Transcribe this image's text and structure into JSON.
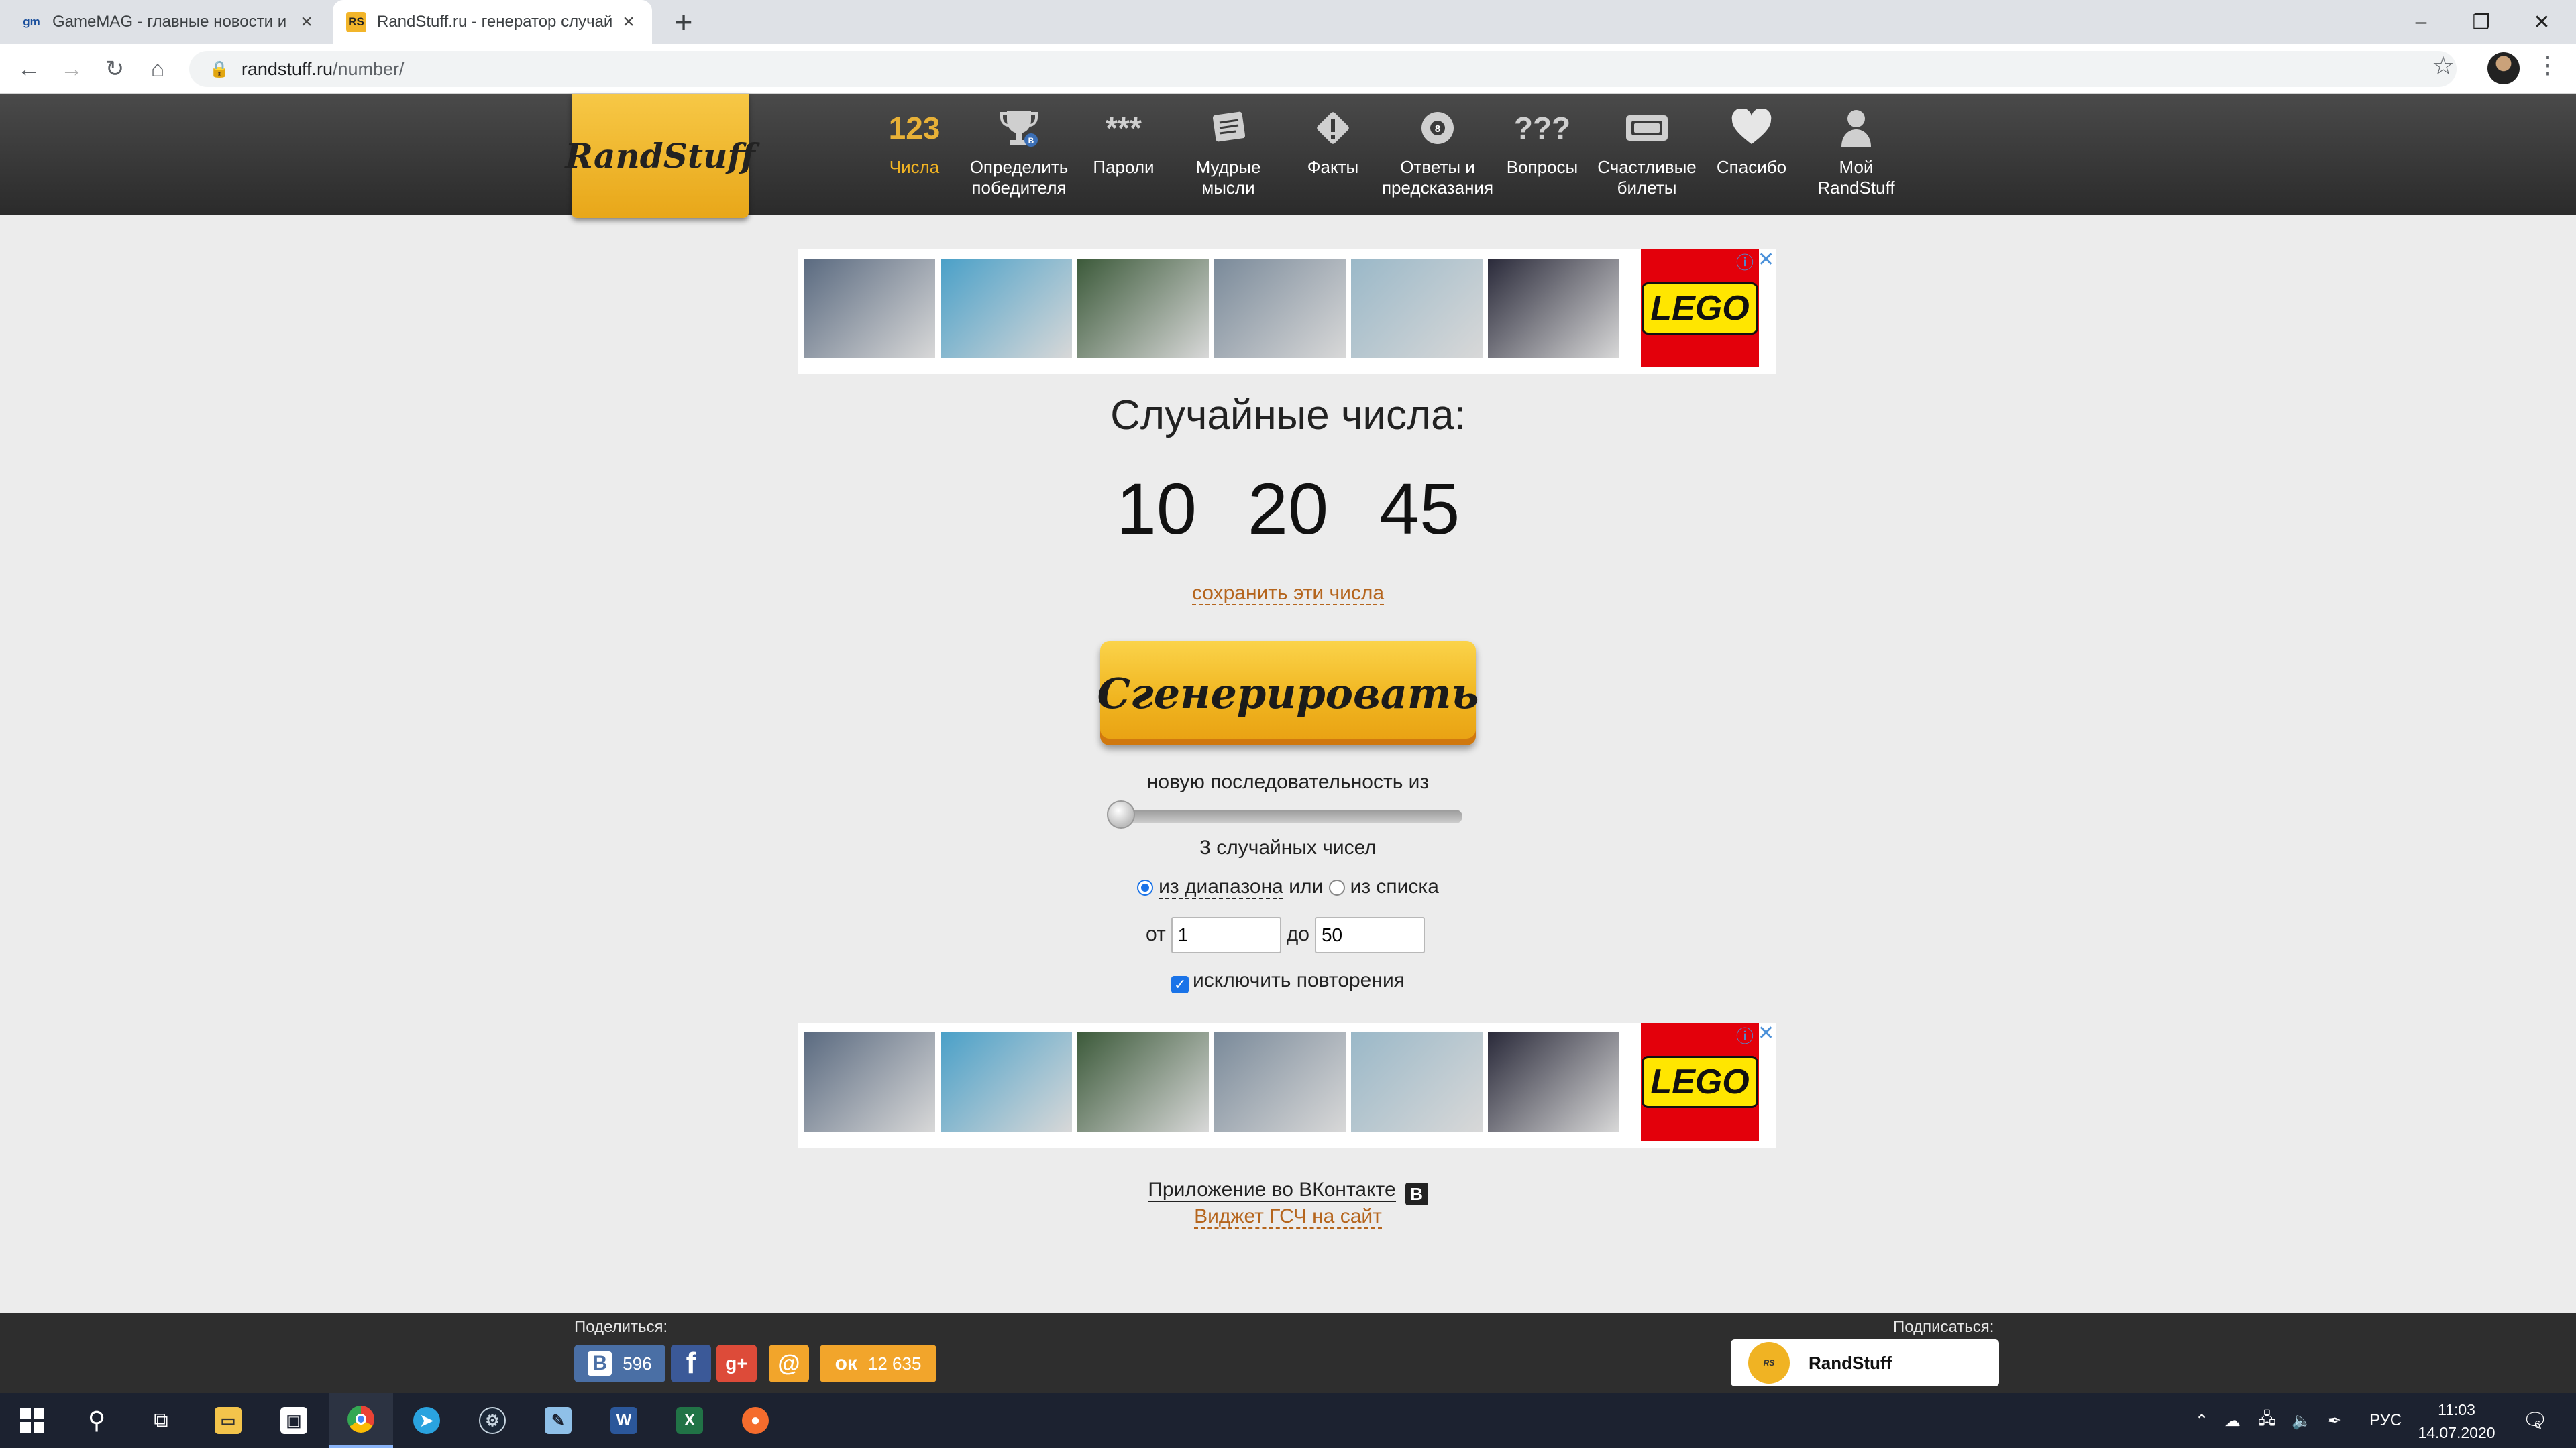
{
  "browser": {
    "tabs": [
      {
        "favicon": "gm",
        "title": "GameMAG - главные новости и"
      },
      {
        "favicon": "RS",
        "title": "RandStuff.ru - генератор случай"
      }
    ],
    "address_host": "randstuff.ru",
    "address_path": "/number/"
  },
  "site": {
    "logo": "RandStuff",
    "nav": [
      {
        "icon": "123",
        "label": "Числа"
      },
      {
        "icon": "trophy-icon",
        "label": "Определить победителя"
      },
      {
        "icon": "***",
        "label": "Пароли"
      },
      {
        "icon": "scroll-icon",
        "label": "Мудрые мысли"
      },
      {
        "icon": "info-diamond-icon",
        "label": "Факты"
      },
      {
        "icon": "8",
        "label": "Ответы и предсказания"
      },
      {
        "icon": "???",
        "label": "Вопросы"
      },
      {
        "icon": "ticket-icon",
        "label": "Счастливые билеты"
      },
      {
        "icon": "heart-icon",
        "label": "Спасибо"
      },
      {
        "icon": "user-icon",
        "label": "Мой RandStuff"
      }
    ]
  },
  "ad": {
    "brand": "LEGO",
    "thumb_colors": [
      "#5a6a80",
      "#4aa0c8",
      "#3c5a3a",
      "#7a8a9a",
      "#9ab8c8",
      "#2a2a3a"
    ]
  },
  "main": {
    "heading": "Случайные числа:",
    "numbers": [
      "10",
      "20",
      "45"
    ],
    "save_link": "сохранить эти числа",
    "generate_button": "Сгенерировать",
    "sequence_text": "новую последовательность из",
    "count_text": "3 случайных чисел",
    "radio_range": "из диапазона",
    "or_text": "или",
    "radio_list": "из списка",
    "from_label": "от",
    "from_value": "1",
    "to_label": "до",
    "to_value": "50",
    "exclude_repeats": "исключить повторения",
    "vk_app_link": "Приложение во ВКонтакте",
    "widget_link": "Виджет ГСЧ на сайт"
  },
  "footer": {
    "share_label": "Поделиться:",
    "vk_count": "596",
    "ok_count": "12 635",
    "subscribe_label": "Подписаться:",
    "subscribe_name": "RandStuff"
  },
  "taskbar": {
    "language": "РУС",
    "time": "11:03",
    "date": "14.07.2020",
    "notifications": "6"
  }
}
